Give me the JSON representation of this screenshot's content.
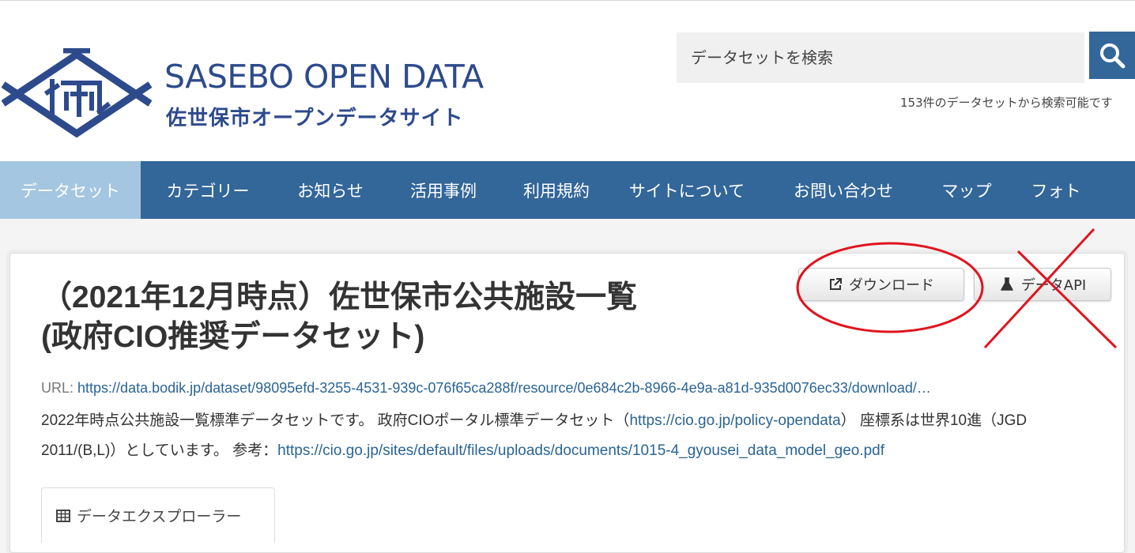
{
  "header": {
    "logo_title": "SASEBO OPEN DATA",
    "logo_subtitle": "佐世保市オープンデータサイト",
    "search_placeholder": "データセットを検索",
    "search_count": "153件のデータセットから検索可能です",
    "brand_color": "#2d4a8c"
  },
  "nav": {
    "items": [
      {
        "label": "データセット",
        "active": true
      },
      {
        "label": "カテゴリー"
      },
      {
        "label": "お知らせ"
      },
      {
        "label": "活用事例"
      },
      {
        "label": "利用規約"
      },
      {
        "label": "サイトについて"
      },
      {
        "label": "お問い合わせ"
      },
      {
        "label": "マップ"
      },
      {
        "label": "フォト"
      }
    ],
    "color": "#336699",
    "active_color": "#a4c6e0"
  },
  "resource": {
    "title_line1": "（2021年12月時点）佐世保市公共施設一覧",
    "title_line2": "(政府CIO推奨データセット)",
    "download_label": "ダウンロード",
    "api_label": "データAPI",
    "url_label": "URL:",
    "url": "https://data.bodik.jp/dataset/98095efd-3255-4531-939c-076f65ca288f/resource/0e684c2b-8966-4e9a-a81d-935d0076ec33/download/…",
    "desc_part1": "2022年時点公共施設一覧標準データセットです。 政府CIOポータル標準データセット（",
    "desc_link1": "https://cio.go.jp/policy-opendata",
    "desc_part2": "） 座標系は世界10進（JGD 2011/(B,L)）としています。 参考：",
    "desc_link2": "https://cio.go.jp/sites/default/files/uploads/documents/1015-4_gyousei_data_model_geo.pdf",
    "tab_label": "データエクスプローラー"
  }
}
